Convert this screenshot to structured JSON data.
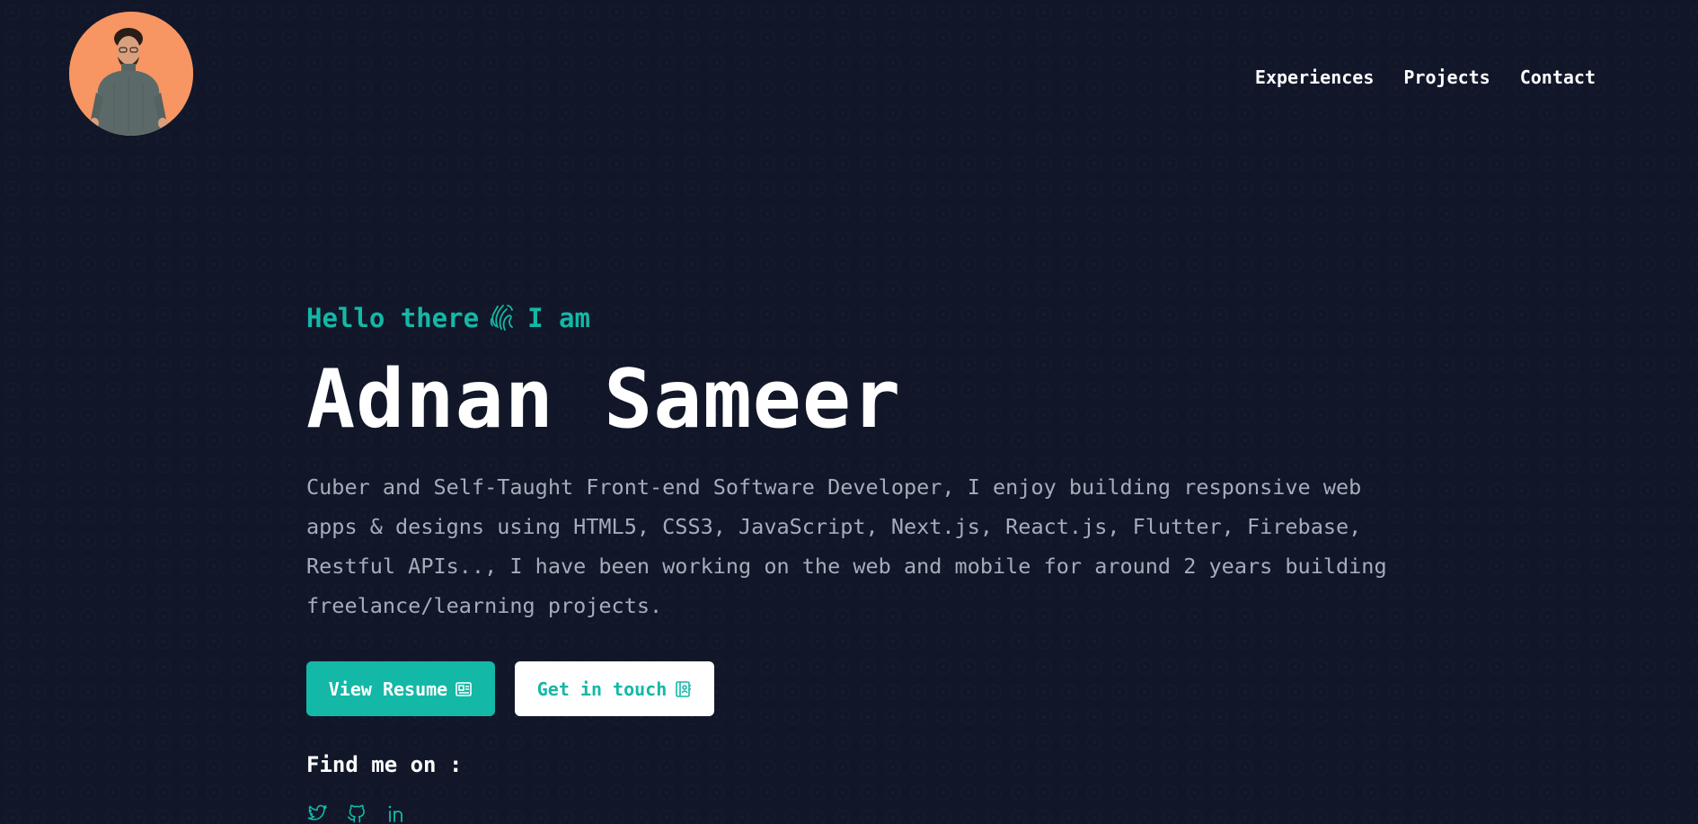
{
  "header": {
    "avatar_alt": "Adnan Sameer",
    "nav": [
      {
        "label": "Experiences"
      },
      {
        "label": "Projects"
      },
      {
        "label": "Contact"
      }
    ]
  },
  "hero": {
    "greeting_prefix": "Hello there",
    "greeting_suffix": "I am",
    "name": "Adnan Sameer",
    "bio": "Cuber and Self-Taught Front-end Software Developer, I enjoy building responsive web apps & designs using HTML5, CSS3, JavaScript, Next.js, React.js, Flutter, Firebase, Restful APIs.., I have been working on the web and mobile for around 2 years building freelance/learning projects.",
    "buttons": {
      "resume_label": "View Resume",
      "contact_label": "Get in touch"
    },
    "find_me_label": "Find me on :",
    "socials": [
      {
        "icon": "twitter-icon"
      },
      {
        "icon": "github-icon"
      },
      {
        "icon": "linkedin-icon"
      }
    ]
  },
  "colors": {
    "background": "#111729",
    "accent": "#14b8a6",
    "avatar_bg": "#f79563",
    "text": "#ffffff",
    "muted_text": "#a5adbb"
  }
}
